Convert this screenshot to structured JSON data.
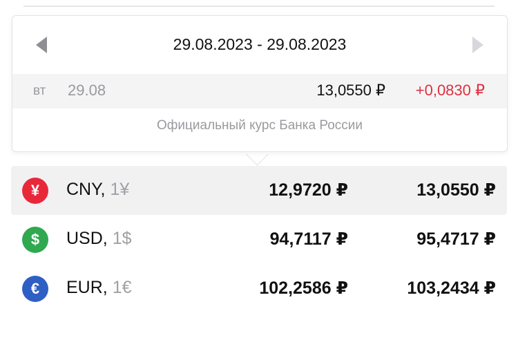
{
  "popover": {
    "date_range": "29.08.2023 - 29.08.2023",
    "day": {
      "weekday": "вт",
      "date": "29.08",
      "rate": "13,0550 ₽",
      "change": "+0,0830 ₽"
    },
    "source_note": "Официальный курс Банка России"
  },
  "currencies": [
    {
      "code": "CNY,",
      "unit": "1¥",
      "symbol": "¥",
      "color": "#e8283a",
      "buy": "12,9720 ₽",
      "sell": "13,0550 ₽"
    },
    {
      "code": "USD,",
      "unit": "1$",
      "symbol": "$",
      "color": "#2fa84f",
      "buy": "94,7117 ₽",
      "sell": "95,4717 ₽"
    },
    {
      "code": "EUR,",
      "unit": "1€",
      "symbol": "€",
      "color": "#2f5fc4",
      "buy": "102,2586 ₽",
      "sell": "103,2434 ₽"
    }
  ],
  "colors": {
    "positive_change": "#e0303f",
    "muted_text": "#9a9a9f"
  }
}
